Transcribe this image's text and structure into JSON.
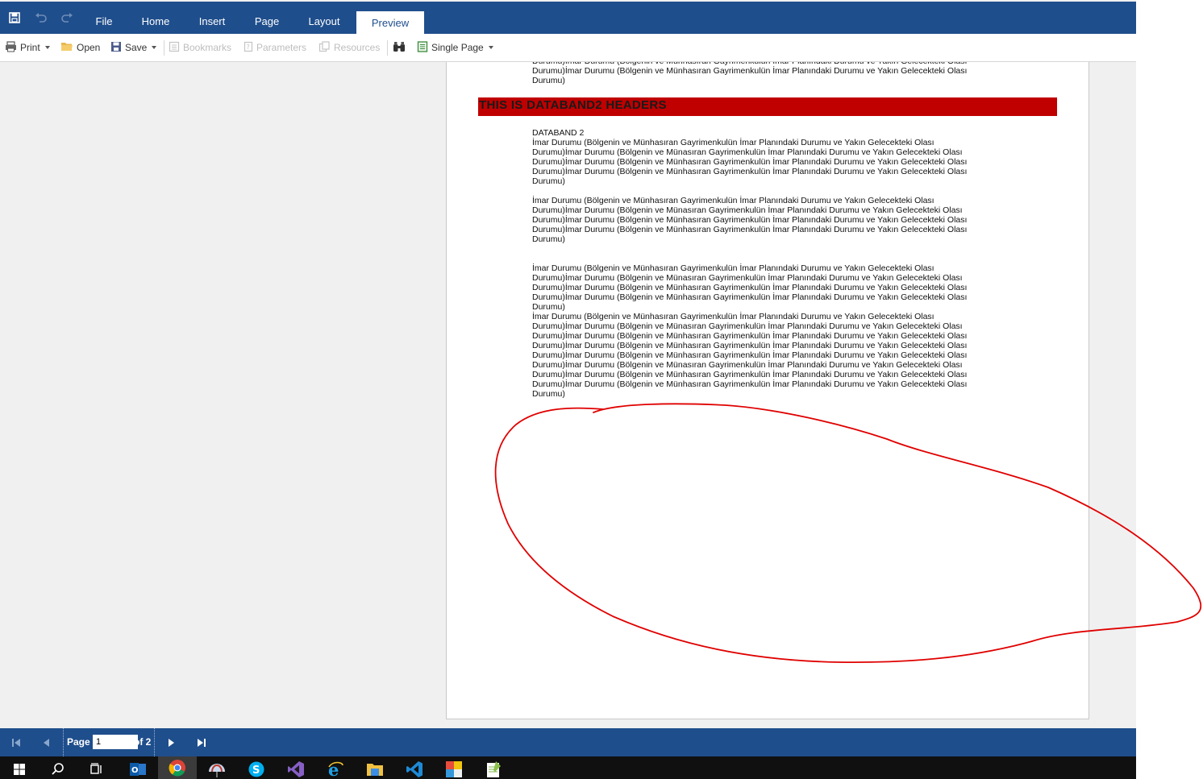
{
  "ribbon": {
    "tabs": [
      "File",
      "Home",
      "Insert",
      "Page",
      "Layout",
      "Preview"
    ],
    "active_tab": "Preview"
  },
  "toolbar": {
    "print": "Print",
    "open": "Open",
    "save": "Save",
    "bookmarks": "Bookmarks",
    "parameters": "Parameters",
    "resources": "Resources",
    "view_mode": "Single Page"
  },
  "document": {
    "top_lines": "Durumu)İmar Durumu (Bölgenin ve Münhasıran Gayrimenkulün İmar Planındaki Durumu ve Yakın Gelecekteki Olası\nDurumu)İmar Durumu (Bölgenin ve Münhasıran Gayrimenkulün İmar Planındaki Durumu ve Yakın Gelecekteki Olası\nDurumu)",
    "header_band": "THIS IS DATABAND2 HEADERS",
    "block1": "DATABAND 2\nİmar Durumu (Bölgenin ve Münhasıran Gayrimenkulün İmar Planındaki Durumu ve Yakın Gelecekteki Olası\nDurumu)İmar Durumu (Bölgenin ve Münasıran Gayrimenkulün İmar Planındaki Durumu ve Yakın Gelecekteki Olası\nDurumu)İmar Durumu (Bölgenin ve Münhasıran Gayrimenkulün İmar Planındaki Durumu ve Yakın Gelecekteki Olası\nDurumu)İmar Durumu (Bölgenin ve Münhasıran Gayrimenkulün İmar Planındaki Durumu ve Yakın Gelecekteki Olası\nDurumu)",
    "block2": "İmar Durumu (Bölgenin ve Münhasıran Gayrimenkulün İmar Planındaki Durumu ve Yakın Gelecekteki Olası\nDurumu)İmar Durumu (Bölgenin ve Münasıran Gayrimenkulün İmar Planındaki Durumu ve Yakın Gelecekteki Olası\nDurumu)İmar Durumu (Bölgenin ve Münhasıran Gayrimenkulün İmar Planındaki Durumu ve Yakın Gelecekteki Olası\nDurumu)İmar Durumu (Bölgenin ve Münhasıran Gayrimenkulün İmar Planındaki Durumu ve Yakın Gelecekteki Olası\nDurumu)",
    "block3": "İmar Durumu (Bölgenin ve Münhasıran Gayrimenkulün İmar Planındaki Durumu ve Yakın Gelecekteki Olası\nDurumu)İmar Durumu (Bölgenin ve Münasıran Gayrimenkulün İmar Planındaki Durumu ve Yakın Gelecekteki Olası\nDurumu)İmar Durumu (Bölgenin ve Münhasıran Gayrimenkulün İmar Planındaki Durumu ve Yakın Gelecekteki Olası\nDurumu)İmar Durumu (Bölgenin ve Münhasıran Gayrimenkulün İmar Planındaki Durumu ve Yakın Gelecekteki Olası\nDurumu)\nİmar Durumu (Bölgenin ve Münhasıran Gayrimenkulün İmar Planındaki Durumu ve Yakın Gelecekteki Olası\nDurumu)İmar Durumu (Bölgenin ve Münasıran Gayrimenkulün İmar Planındaki Durumu ve Yakın Gelecekteki Olası\nDurumu)İmar Durumu (Bölgenin ve Münhasıran Gayrimenkulün İmar Planındaki Durumu ve Yakın Gelecekteki Olası\nDurumu)İmar Durumu (Bölgenin ve Münhasıran Gayrimenkulün İmar Planındaki Durumu ve Yakın Gelecekteki Olası\nDurumu)İmar Durumu (Bölgenin ve Münhasıran Gayrimenkulün İmar Planındaki Durumu ve Yakın Gelecekteki Olası\nDurumu)İmar Durumu (Bölgenin ve Münasıran Gayrimenkulün İmar Planındaki Durumu ve Yakın Gelecekteki Olası\nDurumu)İmar Durumu (Bölgenin ve Münhasıran Gayrimenkulün İmar Planındaki Durumu ve Yakın Gelecekteki Olası\nDurumu)İmar Durumu (Bölgenin ve Münhasıran Gayrimenkulün İmar Planındaki Durumu ve Yakın Gelecekteki Olası\nDurumu)"
  },
  "navigation": {
    "page_label": "Page",
    "page_value": "1",
    "of_label": "of 2"
  },
  "icons": {
    "save_quick": "save-icon",
    "undo": "undo-icon",
    "redo": "redo-icon",
    "find": "binoculars-icon",
    "first": "first-page-icon",
    "prev": "prev-page-icon",
    "next": "next-page-icon",
    "last": "last-page-icon"
  },
  "colors": {
    "ribbon": "#1f4e8c",
    "header_band": "#c00000",
    "annotation": "#e00000",
    "taskbar": "#101010"
  }
}
